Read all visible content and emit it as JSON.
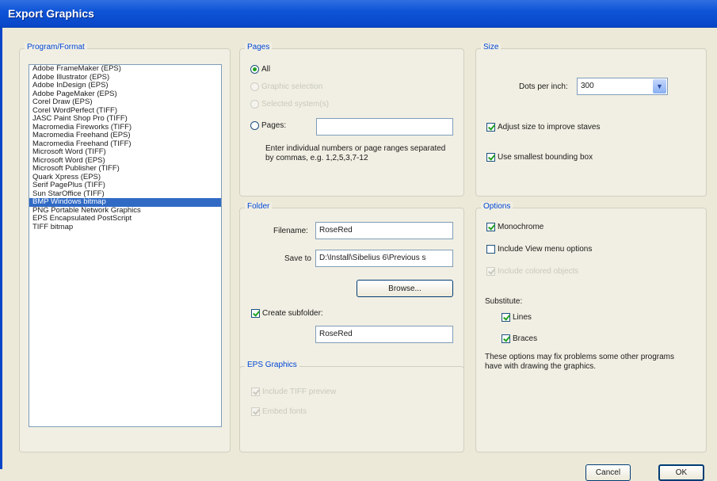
{
  "window": {
    "title": "Export Graphics"
  },
  "program_format": {
    "legend": "Program/Format",
    "items": [
      "Adobe FrameMaker (EPS)",
      "Adobe Illustrator (EPS)",
      "Adobe InDesign (EPS)",
      "Adobe PageMaker (EPS)",
      "Corel Draw (EPS)",
      "Corel WordPerfect (TIFF)",
      "JASC Paint Shop Pro (TIFF)",
      "Macromedia Fireworks (TIFF)",
      "Macromedia Freehand (EPS)",
      "Macromedia Freehand (TIFF)",
      "Microsoft Word (TIFF)",
      "Microsoft Word (EPS)",
      "Microsoft Publisher (TIFF)",
      "Quark Xpress (EPS)",
      "Serif PagePlus (TIFF)",
      "Sun StarOffice (TIFF)",
      "BMP Windows bitmap",
      "PNG Portable Network Graphics",
      "EPS Encapsulated PostScript",
      "TIFF bitmap"
    ],
    "selected": "BMP Windows bitmap"
  },
  "pages": {
    "legend": "Pages",
    "all": "All",
    "graphic_selection": "Graphic selection",
    "selected_systems": "Selected system(s)",
    "pages_label": "Pages:",
    "pages_value": "",
    "hint": "Enter individual numbers or page ranges separated by commas, e.g. 1,2,5,3,7-12"
  },
  "folder": {
    "legend": "Folder",
    "filename_label": "Filename:",
    "filename_value": "RoseRed",
    "saveto_label": "Save to",
    "saveto_value": "D:\\Install\\Sibelius 6\\Previous s",
    "browse_label": "Browse...",
    "create_subfolder_label": "Create subfolder:",
    "subfolder_value": "RoseRed"
  },
  "eps_graphics": {
    "legend": "EPS Graphics",
    "include_tiff_preview": "Include TIFF preview",
    "embed_fonts": "Embed fonts"
  },
  "size": {
    "legend": "Size",
    "dpi_label": "Dots per inch:",
    "dpi_value": "300",
    "adjust_size": "Adjust size to improve staves",
    "smallest_bbox": "Use smallest bounding box"
  },
  "options": {
    "legend": "Options",
    "monochrome": "Monochrome",
    "include_view_menu": "Include View menu options",
    "include_colored": "Include colored objects",
    "substitute_label": "Substitute:",
    "lines": "Lines",
    "braces": "Braces",
    "note": "These options may fix problems some other programs have with drawing the graphics."
  },
  "buttons": {
    "cancel": "Cancel",
    "ok": "OK"
  }
}
